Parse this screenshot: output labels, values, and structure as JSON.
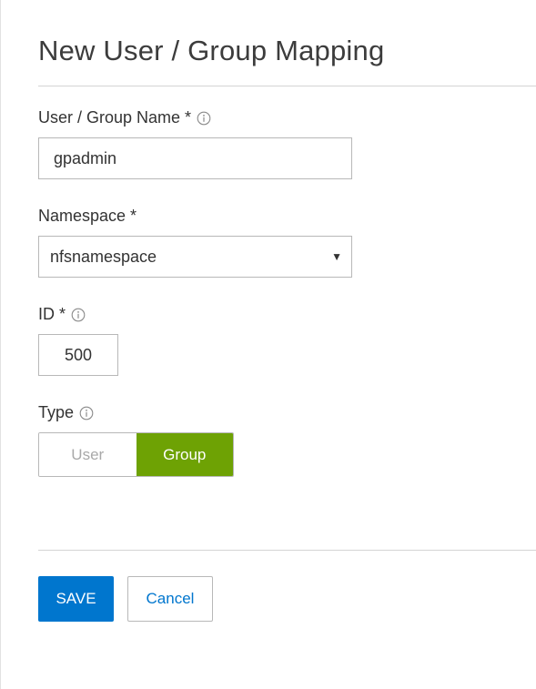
{
  "dialog": {
    "title": "New User / Group Mapping"
  },
  "form": {
    "name": {
      "label": "User / Group Name *",
      "value": "gpadmin"
    },
    "namespace": {
      "label": "Namespace *",
      "value": "nfsnamespace"
    },
    "id": {
      "label": "ID *",
      "value": "500"
    },
    "type": {
      "label": "Type",
      "options": [
        "User",
        "Group"
      ],
      "selected": "Group"
    }
  },
  "actions": {
    "save_label": "SAVE",
    "cancel_label": "Cancel"
  },
  "colors": {
    "primary": "#0076ce",
    "toggle_active": "#6ea204",
    "border": "#b8b8b8"
  },
  "icons": {
    "info": "info-circle-icon",
    "dropdown": "caret-down-icon"
  }
}
